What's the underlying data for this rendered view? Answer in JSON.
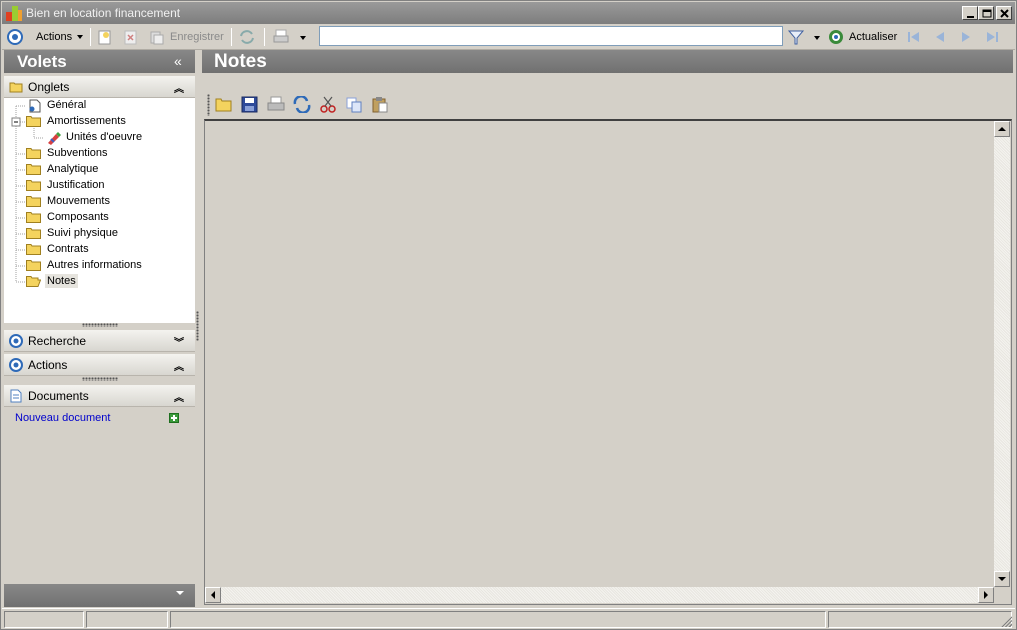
{
  "window": {
    "title": "Bien en location financement"
  },
  "toolbar": {
    "actions_label": "Actions",
    "save_label": "Enregistrer",
    "search_value": "",
    "refresh_label": "Actualiser"
  },
  "left_panel": {
    "title": "Volets",
    "collapse_glyph": "«",
    "sections": {
      "onglets": "Onglets",
      "recherche": "Recherche",
      "actions": "Actions",
      "documents": "Documents"
    },
    "tree": {
      "items": [
        {
          "label": "Général",
          "icon": "document-icon"
        },
        {
          "label": "Amortissements",
          "icon": "folder-icon"
        },
        {
          "label": "Unités d'oeuvre",
          "icon": "pencil-icon"
        },
        {
          "label": "Subventions",
          "icon": "folder-icon"
        },
        {
          "label": "Analytique",
          "icon": "folder-icon"
        },
        {
          "label": "Justification",
          "icon": "folder-icon"
        },
        {
          "label": "Mouvements",
          "icon": "folder-icon"
        },
        {
          "label": "Composants",
          "icon": "folder-icon"
        },
        {
          "label": "Suivi physique",
          "icon": "folder-icon"
        },
        {
          "label": "Contrats",
          "icon": "folder-icon"
        },
        {
          "label": "Autres informations",
          "icon": "folder-icon"
        },
        {
          "label": "Notes",
          "icon": "open-folder-icon"
        }
      ],
      "selected": "Notes"
    },
    "documents": {
      "new_document_label": "Nouveau document"
    }
  },
  "right_panel": {
    "title": "Notes"
  },
  "colors": {
    "header_gradient_top": "#888888",
    "header_gradient_bottom": "#707070",
    "link_color": "#0000cc",
    "folder_yellow": "#f4d35e",
    "background": "#d4d0c8"
  }
}
